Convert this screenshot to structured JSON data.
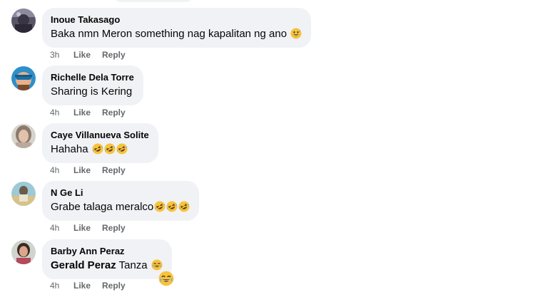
{
  "comments": [
    {
      "author": "Inoue Takasago",
      "text": "Baka nmn Meron something nag kapalitan ng ano",
      "emoji": "grinning-sweat-emoji",
      "time": "3h",
      "like": "Like",
      "reply": "Reply"
    },
    {
      "author": "Richelle Dela Torre",
      "text": "Sharing is Kering",
      "time": "4h",
      "like": "Like",
      "reply": "Reply"
    },
    {
      "author": "Caye Villanueva Solite",
      "text": "Hahaha",
      "emoji": "rolling-laughing-emoji",
      "time": "4h",
      "like": "Like",
      "reply": "Reply"
    },
    {
      "author": "N Ge Li",
      "text": "Grabe talaga meralco",
      "emoji": "rolling-laughing-emoji",
      "time": "4h",
      "like": "Like",
      "reply": "Reply"
    },
    {
      "author": "Barby Ann Peraz",
      "mention": "Gerald Peraz",
      "text": "Tanza",
      "emoji": "laughing-tears-emoji",
      "time": "4h",
      "like": "Like",
      "reply": "Reply"
    }
  ],
  "colors": {
    "bubble": "#f0f2f5",
    "secondary_text": "#65676b",
    "primary_text": "#050505"
  }
}
